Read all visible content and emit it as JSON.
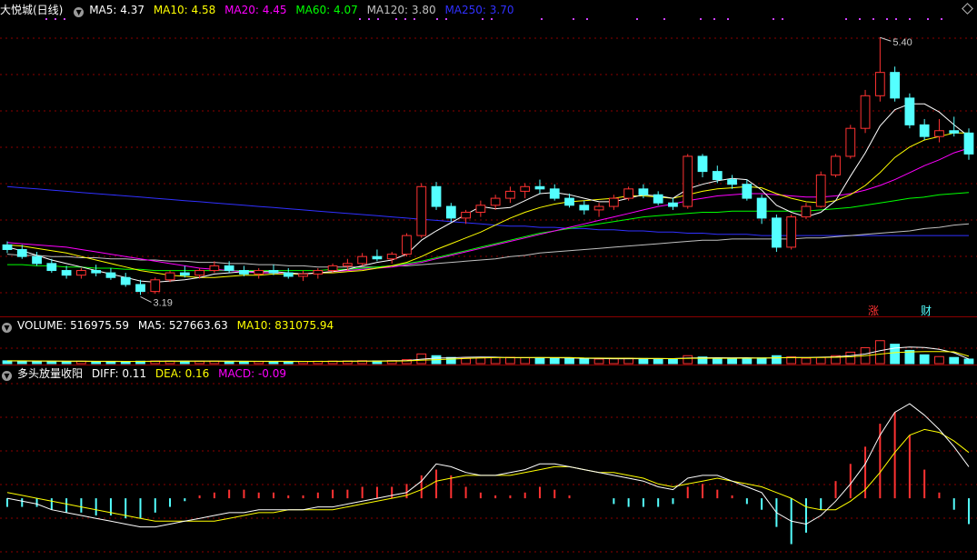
{
  "price_header": {
    "title": "大悦城(日线)",
    "ma5": "MA5: 4.37",
    "ma10": "MA10: 4.58",
    "ma20": "MA20: 4.45",
    "ma60": "MA60: 4.07",
    "ma120": "MA120: 3.80",
    "ma250": "MA250: 3.70"
  },
  "volume_header": {
    "title": "VOLUME: 516975.59",
    "ma5": "MA5: 527663.63",
    "ma10": "MA10: 831075.94"
  },
  "macd_header": {
    "title": "多头放量收阳",
    "diff": "DIFF: 0.11",
    "dea": "DEA: 0.16",
    "macd": "MACD: -0.09"
  },
  "annotations": {
    "high_label": "5.40",
    "low_label": "3.19",
    "zhang_label": "涨",
    "cai_label": "财"
  },
  "colors": {
    "up": "#ff3232",
    "down": "#54ffff",
    "ma5": "#ffffff",
    "ma10": "#ffff00",
    "ma20": "#ff00ff",
    "ma60": "#00ff00",
    "ma120": "#c0c0c0",
    "ma250": "#3030ff",
    "grid": "#8b0000",
    "diff": "#ffffff",
    "dea": "#ffff00"
  },
  "chart_data": [
    {
      "type": "candlestick",
      "ylim": [
        3.1,
        5.55
      ],
      "ohlc": [
        [
          3.62,
          3.65,
          3.55,
          3.58
        ],
        [
          3.58,
          3.62,
          3.5,
          3.52
        ],
        [
          3.52,
          3.56,
          3.44,
          3.46
        ],
        [
          3.46,
          3.5,
          3.38,
          3.4
        ],
        [
          3.4,
          3.44,
          3.33,
          3.36
        ],
        [
          3.36,
          3.42,
          3.33,
          3.4
        ],
        [
          3.4,
          3.45,
          3.35,
          3.38
        ],
        [
          3.38,
          3.42,
          3.32,
          3.34
        ],
        [
          3.34,
          3.38,
          3.26,
          3.28
        ],
        [
          3.28,
          3.32,
          3.19,
          3.22
        ],
        [
          3.22,
          3.34,
          3.2,
          3.32
        ],
        [
          3.32,
          3.4,
          3.3,
          3.38
        ],
        [
          3.38,
          3.44,
          3.34,
          3.36
        ],
        [
          3.36,
          3.42,
          3.33,
          3.4
        ],
        [
          3.4,
          3.48,
          3.38,
          3.44
        ],
        [
          3.44,
          3.48,
          3.38,
          3.4
        ],
        [
          3.4,
          3.44,
          3.35,
          3.37
        ],
        [
          3.37,
          3.42,
          3.33,
          3.4
        ],
        [
          3.4,
          3.45,
          3.36,
          3.38
        ],
        [
          3.38,
          3.42,
          3.33,
          3.35
        ],
        [
          3.35,
          3.4,
          3.31,
          3.37
        ],
        [
          3.37,
          3.42,
          3.33,
          3.4
        ],
        [
          3.4,
          3.46,
          3.38,
          3.44
        ],
        [
          3.44,
          3.5,
          3.4,
          3.46
        ],
        [
          3.46,
          3.55,
          3.44,
          3.52
        ],
        [
          3.52,
          3.58,
          3.48,
          3.5
        ],
        [
          3.5,
          3.56,
          3.46,
          3.54
        ],
        [
          3.54,
          3.72,
          3.52,
          3.7
        ],
        [
          3.7,
          4.15,
          3.68,
          4.12
        ],
        [
          4.12,
          4.16,
          3.92,
          3.95
        ],
        [
          3.95,
          3.98,
          3.82,
          3.85
        ],
        [
          3.85,
          3.92,
          3.8,
          3.9
        ],
        [
          3.9,
          4.0,
          3.86,
          3.96
        ],
        [
          3.96,
          4.05,
          3.92,
          4.02
        ],
        [
          4.02,
          4.12,
          3.98,
          4.08
        ],
        [
          4.08,
          4.15,
          4.02,
          4.12
        ],
        [
          4.12,
          4.18,
          4.06,
          4.1
        ],
        [
          4.1,
          4.14,
          4.0,
          4.02
        ],
        [
          4.02,
          4.06,
          3.94,
          3.96
        ],
        [
          3.96,
          4.0,
          3.88,
          3.92
        ],
        [
          3.92,
          3.98,
          3.86,
          3.95
        ],
        [
          3.95,
          4.05,
          3.92,
          4.02
        ],
        [
          4.02,
          4.12,
          4.0,
          4.1
        ],
        [
          4.1,
          4.14,
          4.02,
          4.05
        ],
        [
          4.05,
          4.08,
          3.96,
          3.98
        ],
        [
          3.98,
          4.02,
          3.92,
          3.95
        ],
        [
          3.95,
          4.4,
          3.93,
          4.38
        ],
        [
          4.38,
          4.4,
          4.2,
          4.25
        ],
        [
          4.25,
          4.3,
          4.15,
          4.18
        ],
        [
          4.18,
          4.22,
          4.1,
          4.14
        ],
        [
          4.14,
          4.18,
          4.0,
          4.02
        ],
        [
          4.02,
          4.05,
          3.8,
          3.85
        ],
        [
          3.85,
          3.88,
          3.56,
          3.6
        ],
        [
          3.6,
          3.88,
          3.58,
          3.86
        ],
        [
          3.86,
          3.98,
          3.84,
          3.95
        ],
        [
          3.95,
          4.25,
          3.94,
          4.22
        ],
        [
          4.22,
          4.4,
          4.2,
          4.38
        ],
        [
          4.38,
          4.65,
          4.36,
          4.62
        ],
        [
          4.62,
          4.95,
          4.58,
          4.9
        ],
        [
          4.9,
          5.4,
          4.85,
          5.1
        ],
        [
          5.1,
          5.15,
          4.85,
          4.88
        ],
        [
          4.88,
          4.92,
          4.62,
          4.65
        ],
        [
          4.65,
          4.7,
          4.52,
          4.55
        ],
        [
          4.55,
          4.7,
          4.5,
          4.6
        ],
        [
          4.6,
          4.72,
          4.55,
          4.58
        ],
        [
          4.58,
          4.62,
          4.35,
          4.4
        ]
      ],
      "ma5": [
        3.6,
        3.57,
        3.53,
        3.49,
        3.46,
        3.43,
        3.4,
        3.37,
        3.34,
        3.31,
        3.3,
        3.31,
        3.32,
        3.34,
        3.37,
        3.38,
        3.39,
        3.39,
        3.39,
        3.38,
        3.37,
        3.38,
        3.39,
        3.41,
        3.44,
        3.47,
        3.49,
        3.54,
        3.66,
        3.74,
        3.81,
        3.88,
        3.95,
        3.93,
        3.94,
        4.0,
        4.06,
        4.07,
        4.05,
        4.02,
        3.99,
        3.99,
        4.02,
        4.05,
        4.04,
        4.02,
        4.1,
        4.14,
        4.17,
        4.19,
        4.18,
        4.09,
        3.96,
        3.9,
        3.86,
        3.9,
        4.0,
        4.21,
        4.41,
        4.64,
        4.78,
        4.83,
        4.83,
        4.76,
        4.65,
        4.55
      ],
      "ma10": [
        3.62,
        3.61,
        3.59,
        3.57,
        3.55,
        3.52,
        3.49,
        3.46,
        3.43,
        3.4,
        3.38,
        3.36,
        3.35,
        3.34,
        3.34,
        3.35,
        3.36,
        3.36,
        3.37,
        3.37,
        3.37,
        3.38,
        3.38,
        3.39,
        3.4,
        3.42,
        3.44,
        3.47,
        3.52,
        3.58,
        3.63,
        3.68,
        3.73,
        3.79,
        3.85,
        3.9,
        3.94,
        3.97,
        3.99,
        4.0,
        4.01,
        4.02,
        4.04,
        4.04,
        4.03,
        4.02,
        4.05,
        4.08,
        4.1,
        4.11,
        4.12,
        4.11,
        4.06,
        4.02,
        3.99,
        3.98,
        4.0,
        4.05,
        4.13,
        4.24,
        4.37,
        4.46,
        4.52,
        4.55,
        4.58,
        4.58
      ],
      "ma20": [
        3.64,
        3.63,
        3.62,
        3.61,
        3.6,
        3.58,
        3.56,
        3.54,
        3.52,
        3.5,
        3.48,
        3.46,
        3.44,
        3.42,
        3.41,
        3.4,
        3.39,
        3.38,
        3.38,
        3.37,
        3.37,
        3.38,
        3.39,
        3.4,
        3.41,
        3.42,
        3.43,
        3.45,
        3.47,
        3.5,
        3.53,
        3.56,
        3.59,
        3.62,
        3.65,
        3.68,
        3.71,
        3.74,
        3.77,
        3.8,
        3.83,
        3.86,
        3.89,
        3.92,
        3.95,
        3.97,
        4.0,
        4.02,
        4.04,
        4.05,
        4.06,
        4.06,
        4.05,
        4.04,
        4.03,
        4.03,
        4.04,
        4.06,
        4.09,
        4.13,
        4.18,
        4.24,
        4.3,
        4.35,
        4.41,
        4.45
      ],
      "ma60": [
        3.45,
        3.45,
        3.44,
        3.44,
        3.43,
        3.43,
        3.42,
        3.42,
        3.41,
        3.41,
        3.4,
        3.4,
        3.4,
        3.4,
        3.4,
        3.4,
        3.4,
        3.4,
        3.4,
        3.4,
        3.4,
        3.4,
        3.41,
        3.41,
        3.42,
        3.43,
        3.44,
        3.46,
        3.48,
        3.51,
        3.54,
        3.57,
        3.6,
        3.63,
        3.66,
        3.69,
        3.72,
        3.74,
        3.76,
        3.78,
        3.8,
        3.82,
        3.84,
        3.86,
        3.87,
        3.88,
        3.89,
        3.9,
        3.9,
        3.91,
        3.91,
        3.91,
        3.91,
        3.91,
        3.91,
        3.92,
        3.93,
        3.94,
        3.96,
        3.98,
        4.0,
        4.02,
        4.03,
        4.05,
        4.06,
        4.07
      ],
      "ma120": [
        3.54,
        3.53,
        3.53,
        3.52,
        3.52,
        3.51,
        3.51,
        3.5,
        3.5,
        3.49,
        3.49,
        3.48,
        3.48,
        3.47,
        3.47,
        3.46,
        3.46,
        3.45,
        3.45,
        3.44,
        3.44,
        3.43,
        3.43,
        3.43,
        3.43,
        3.43,
        3.44,
        3.44,
        3.45,
        3.46,
        3.47,
        3.48,
        3.49,
        3.5,
        3.52,
        3.53,
        3.55,
        3.56,
        3.57,
        3.58,
        3.59,
        3.6,
        3.61,
        3.62,
        3.63,
        3.64,
        3.65,
        3.66,
        3.66,
        3.67,
        3.67,
        3.67,
        3.67,
        3.67,
        3.68,
        3.68,
        3.69,
        3.7,
        3.71,
        3.72,
        3.73,
        3.74,
        3.76,
        3.77,
        3.79,
        3.8
      ],
      "ma250": [
        4.12,
        4.11,
        4.1,
        4.09,
        4.08,
        4.07,
        4.06,
        4.05,
        4.04,
        4.03,
        4.02,
        4.01,
        4.0,
        3.99,
        3.98,
        3.97,
        3.96,
        3.95,
        3.94,
        3.93,
        3.92,
        3.91,
        3.9,
        3.89,
        3.88,
        3.87,
        3.86,
        3.85,
        3.84,
        3.83,
        3.82,
        3.81,
        3.8,
        3.79,
        3.78,
        3.78,
        3.77,
        3.77,
        3.76,
        3.76,
        3.75,
        3.75,
        3.74,
        3.74,
        3.73,
        3.73,
        3.72,
        3.72,
        3.71,
        3.71,
        3.71,
        3.7,
        3.7,
        3.7,
        3.7,
        3.7,
        3.7,
        3.7,
        3.7,
        3.7,
        3.7,
        3.7,
        3.7,
        3.7,
        3.7,
        3.7
      ]
    },
    {
      "type": "bar",
      "title": "VOLUME",
      "ylim": [
        0,
        3500000
      ],
      "values": [
        320000,
        300000,
        280000,
        260000,
        250000,
        270000,
        240000,
        230000,
        250000,
        280000,
        300000,
        290000,
        270000,
        260000,
        280000,
        260000,
        250000,
        240000,
        230000,
        250000,
        260000,
        270000,
        290000,
        300000,
        330000,
        310000,
        340000,
        450000,
        1100000,
        900000,
        700000,
        600000,
        650000,
        700000,
        720000,
        680000,
        640000,
        600000,
        560000,
        540000,
        520000,
        560000,
        620000,
        580000,
        540000,
        500000,
        900000,
        750000,
        620000,
        560000,
        540000,
        650000,
        900000,
        760000,
        620000,
        700000,
        900000,
        1300000,
        1800000,
        2600000,
        2200000,
        1500000,
        1000000,
        800000,
        700000,
        516975
      ],
      "ma5": [
        310000,
        300000,
        290000,
        280000,
        270000,
        265000,
        258000,
        250000,
        245000,
        255000,
        270000,
        280000,
        285000,
        280000,
        280000,
        270000,
        265000,
        260000,
        255000,
        250000,
        250000,
        255000,
        262000,
        272000,
        286000,
        300000,
        314000,
        346000,
        508000,
        624000,
        660000,
        720000,
        740000,
        730000,
        674000,
        670000,
        678000,
        668000,
        640000,
        604000,
        572000,
        556000,
        560000,
        564000,
        564000,
        562000,
        628000,
        658000,
        664000,
        654000,
        672000,
        624000,
        654000,
        690000,
        694000,
        726000,
        776000,
        896000,
        1096000,
        1460000,
        1760000,
        1880000,
        1820000,
        1620000,
        1240000,
        527663
      ],
      "ma10": [
        320000,
        315000,
        305000,
        295000,
        285000,
        280000,
        272000,
        265000,
        258000,
        260000,
        265000,
        270000,
        275000,
        278000,
        278000,
        275000,
        272000,
        270000,
        268000,
        265000,
        262000,
        262000,
        265000,
        270000,
        276000,
        283000,
        292000,
        309000,
        377000,
        454000,
        518000,
        582000,
        634000,
        680000,
        692000,
        686000,
        690000,
        700000,
        690000,
        639000,
        623000,
        617000,
        614000,
        602000,
        584000,
        567000,
        592000,
        611000,
        610000,
        609000,
        617000,
        626000,
        656000,
        677000,
        679000,
        694000,
        720000,
        775000,
        892000,
        1077000,
        1243000,
        1328000,
        1358000,
        1357000,
        1342000,
        831075
      ]
    },
    {
      "type": "bar",
      "title": "MACD",
      "ylim": [
        -0.19,
        0.4
      ],
      "series": [
        {
          "name": "DIFF",
          "values": [
            0.0,
            -0.01,
            -0.02,
            -0.04,
            -0.05,
            -0.06,
            -0.07,
            -0.08,
            -0.09,
            -0.1,
            -0.1,
            -0.09,
            -0.08,
            -0.07,
            -0.06,
            -0.05,
            -0.05,
            -0.04,
            -0.04,
            -0.04,
            -0.04,
            -0.03,
            -0.03,
            -0.02,
            -0.01,
            0.0,
            0.01,
            0.02,
            0.06,
            0.12,
            0.11,
            0.09,
            0.08,
            0.08,
            0.09,
            0.1,
            0.12,
            0.12,
            0.11,
            0.1,
            0.09,
            0.08,
            0.07,
            0.06,
            0.04,
            0.03,
            0.07,
            0.08,
            0.08,
            0.06,
            0.04,
            0.02,
            -0.05,
            -0.08,
            -0.09,
            -0.06,
            -0.01,
            0.05,
            0.12,
            0.22,
            0.3,
            0.33,
            0.29,
            0.24,
            0.18,
            0.11
          ]
        },
        {
          "name": "DEA",
          "values": [
            0.02,
            0.01,
            0.0,
            -0.01,
            -0.02,
            -0.03,
            -0.04,
            -0.05,
            -0.06,
            -0.07,
            -0.08,
            -0.08,
            -0.08,
            -0.08,
            -0.08,
            -0.07,
            -0.06,
            -0.05,
            -0.05,
            -0.04,
            -0.04,
            -0.04,
            -0.04,
            -0.03,
            -0.02,
            -0.01,
            0.0,
            0.01,
            0.03,
            0.06,
            0.07,
            0.08,
            0.08,
            0.08,
            0.08,
            0.09,
            0.1,
            0.11,
            0.11,
            0.1,
            0.09,
            0.09,
            0.08,
            0.07,
            0.05,
            0.04,
            0.05,
            0.06,
            0.07,
            0.06,
            0.05,
            0.04,
            0.02,
            0.0,
            -0.03,
            -0.04,
            -0.04,
            -0.01,
            0.03,
            0.09,
            0.16,
            0.22,
            0.24,
            0.23,
            0.2,
            0.16
          ]
        },
        {
          "name": "MACD",
          "values": [
            -0.03,
            -0.03,
            -0.03,
            -0.04,
            -0.05,
            -0.05,
            -0.06,
            -0.06,
            -0.07,
            -0.07,
            -0.05,
            -0.03,
            -0.01,
            0.01,
            0.02,
            0.03,
            0.03,
            0.02,
            0.02,
            0.01,
            0.01,
            0.02,
            0.03,
            0.03,
            0.04,
            0.04,
            0.04,
            0.05,
            0.08,
            0.1,
            0.08,
            0.04,
            0.02,
            0.01,
            0.01,
            0.02,
            0.04,
            0.03,
            0.01,
            0.0,
            0.0,
            -0.02,
            -0.03,
            -0.03,
            -0.03,
            -0.02,
            0.04,
            0.05,
            0.03,
            0.01,
            -0.02,
            -0.04,
            -0.1,
            -0.16,
            -0.12,
            -0.04,
            0.06,
            0.12,
            0.18,
            0.26,
            0.3,
            0.22,
            0.1,
            0.02,
            -0.04,
            -0.09
          ]
        }
      ]
    }
  ]
}
